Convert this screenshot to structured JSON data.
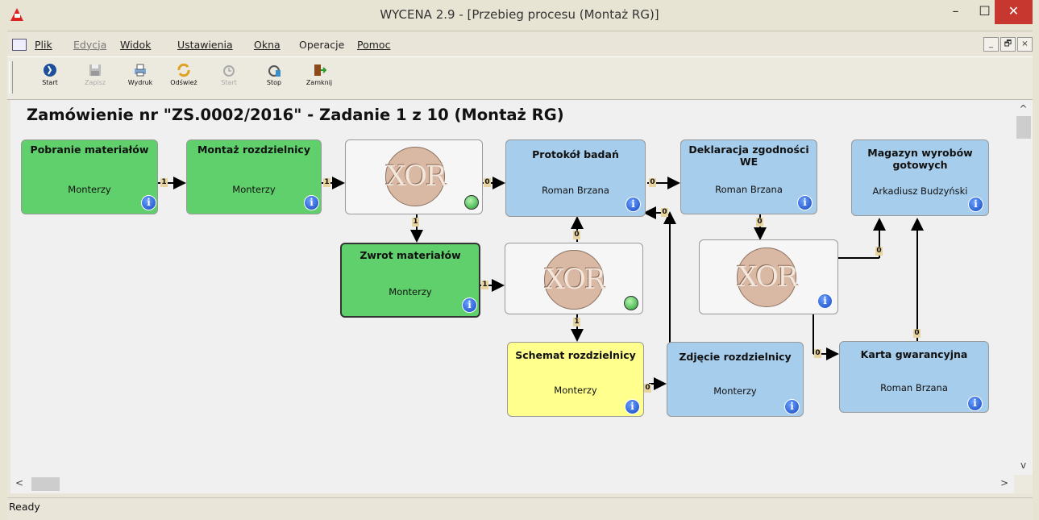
{
  "window": {
    "title": "WYCENA 2.9 - [Przebieg procesu (Montaż RG)]",
    "min": "–",
    "max": "☐",
    "close": "✕"
  },
  "menu": {
    "items": [
      "Plik",
      "Edycja",
      "Widok",
      "Ustawienia",
      "Okna",
      "Operacje",
      "Pomoc"
    ],
    "mdi": [
      "_",
      "🗗",
      "×"
    ]
  },
  "toolbar": {
    "buttons": [
      {
        "label": "Start",
        "icon": "start-icon",
        "enabled": true
      },
      {
        "label": "Zapisz",
        "icon": "save-icon",
        "enabled": false
      },
      {
        "label": "Wydruk",
        "icon": "print-icon",
        "enabled": true
      },
      {
        "label": "Odśwież",
        "icon": "refresh-icon",
        "enabled": true
      },
      {
        "label": "Start",
        "icon": "start-task-icon",
        "enabled": false
      },
      {
        "label": "Stop",
        "icon": "stop-icon",
        "enabled": true
      },
      {
        "label": "Zamknij",
        "icon": "exit-icon",
        "enabled": true
      }
    ]
  },
  "diagram": {
    "heading": "Zamówienie nr \"ZS.0002/2016\"  - Zadanie 1 z 10 (Montaż RG)",
    "nodes": {
      "pobranie": {
        "title": "Pobranie materiałów",
        "sub": "Monterzy"
      },
      "montaz": {
        "title": "Montaż rozdzielnicy",
        "sub": "Monterzy"
      },
      "protokol": {
        "title": "Protokół badań",
        "sub": "Roman Brzana"
      },
      "deklaracja": {
        "title": "Deklaracja zgodności WE",
        "sub": "Roman Brzana"
      },
      "magazyn": {
        "title": "Magazyn wyrobów gotowych",
        "sub": "Arkadiusz Budzyński"
      },
      "zwrot": {
        "title": "Zwrot materiałów",
        "sub": "Monterzy"
      },
      "schemat": {
        "title": "Schemat rozdzielnicy",
        "sub": "Monterzy"
      },
      "zdjecie": {
        "title": "Zdjęcie rozdzielnicy",
        "sub": "Monterzy"
      },
      "karta": {
        "title": "Karta gwarancyjna",
        "sub": "Roman Brzana"
      }
    },
    "xor_label": "XOR",
    "info_glyph": "i",
    "link_labels": {
      "l1": "1",
      "l2": "1",
      "l3": "0",
      "l4": "0",
      "l5": "0",
      "l6": "1",
      "l7": "0",
      "l8": "0",
      "l9": "1",
      "l10": "1",
      "l11": "0",
      "l12": "0",
      "l13": "0",
      "l14": "0"
    },
    "colors": {
      "green": "#5fd06b",
      "blue": "#a6cdeb",
      "yellow": "#ffff8e"
    }
  },
  "scroll": {
    "up": "^",
    "down": "v",
    "left": "<",
    "right": ">"
  },
  "status": {
    "text": "Ready"
  }
}
